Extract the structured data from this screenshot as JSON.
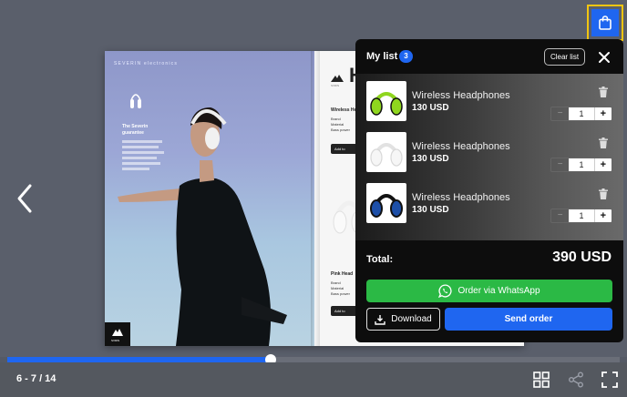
{
  "catalog": {
    "brand_header": "SEVERIN electronics",
    "left_page": {
      "heading": "The Severin guarantee",
      "logo_text": "SVRIN"
    },
    "right_page": {
      "big_letters": "H",
      "logo_text": "SVRIN",
      "products": [
        {
          "name": "Wireless He",
          "spec_labels": [
            "Brand",
            "Material",
            "Bass power"
          ],
          "add_label": "Add to"
        },
        {
          "name": "Pink Head",
          "spec_labels": [
            "Brand",
            "Material",
            "Bass power"
          ],
          "add_label": "Add to"
        }
      ]
    }
  },
  "cart_panel": {
    "title": "My list",
    "count": "3",
    "clear_label": "Clear list",
    "items": [
      {
        "name": "Wireless Headphones",
        "price": "130 USD",
        "qty": "1",
        "minus": "−",
        "plus": "+",
        "color": "#8fd61e"
      },
      {
        "name": "Wireless Headphones",
        "price": "130 USD",
        "qty": "1",
        "minus": "−",
        "plus": "+",
        "color": "#f2f2f2"
      },
      {
        "name": "Wireless Headphones",
        "price": "130 USD",
        "qty": "1",
        "minus": "−",
        "plus": "+",
        "color": "#1d4fa8"
      }
    ],
    "total_label": "Total:",
    "total_value": "390 USD",
    "whatsapp_label": "Order via WhatsApp",
    "download_label": "Download",
    "send_label": "Send order"
  },
  "viewer": {
    "page_counter": "6 - 7 / 14",
    "progress": 0.43
  },
  "colors": {
    "accent": "#1f66f0",
    "whatsapp": "#2bb945",
    "highlight": "#f2c511"
  },
  "icons": [
    "shopping-bag-icon",
    "chevron-left-icon",
    "close-icon",
    "trash-icon",
    "whatsapp-icon",
    "download-icon",
    "grid-icon",
    "share-icon",
    "fullscreen-icon"
  ]
}
